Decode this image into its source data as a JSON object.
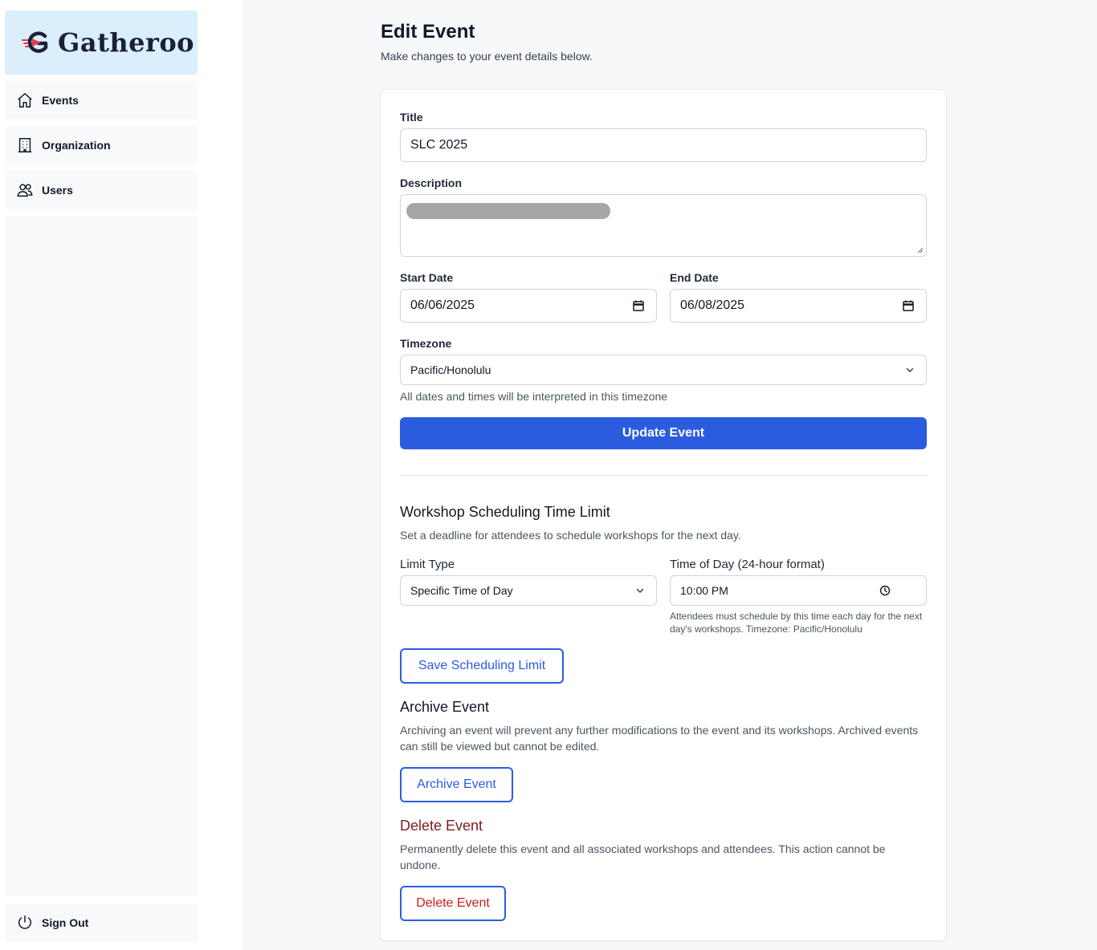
{
  "brand": {
    "name": "Gatheroo"
  },
  "sidebar": {
    "items": [
      {
        "label": "Events",
        "icon": "home-icon"
      },
      {
        "label": "Organization",
        "icon": "building-icon"
      },
      {
        "label": "Users",
        "icon": "users-icon"
      }
    ],
    "sign_out": {
      "label": "Sign Out",
      "icon": "power-icon"
    }
  },
  "page": {
    "title": "Edit Event",
    "subtitle": "Make changes to your event details below."
  },
  "form": {
    "title_label": "Title",
    "title_value": "SLC 2025",
    "description_label": "Description",
    "start_date_label": "Start Date",
    "start_date_value": "06/06/2025",
    "end_date_label": "End Date",
    "end_date_value": "06/08/2025",
    "timezone_label": "Timezone",
    "timezone_value": "Pacific/Honolulu",
    "timezone_help": "All dates and times will be interpreted in this timezone",
    "update_button": "Update Event"
  },
  "scheduling": {
    "title": "Workshop Scheduling Time Limit",
    "description": "Set a deadline for attendees to schedule workshops for the next day.",
    "limit_type_label": "Limit Type",
    "limit_type_value": "Specific Time of Day",
    "time_label": "Time of Day (24-hour format)",
    "time_value": "10:00 PM",
    "time_help": "Attendees must schedule by this time each day for the next day's workshops. Timezone: Pacific/Honolulu",
    "save_button": "Save Scheduling Limit"
  },
  "archive": {
    "title": "Archive Event",
    "description": "Archiving an event will prevent any further modifications to the event and its workshops. Archived events can still be viewed but cannot be edited.",
    "button": "Archive Event"
  },
  "delete": {
    "title": "Delete Event",
    "description": "Permanently delete this event and all associated workshops and attendees. This action cannot be undone.",
    "button": "Delete Event"
  },
  "colors": {
    "primary": "#2b5ce0",
    "danger_text": "#c81e1e",
    "danger_title": "#7f1d1d",
    "logo_bg": "#daeefc"
  }
}
